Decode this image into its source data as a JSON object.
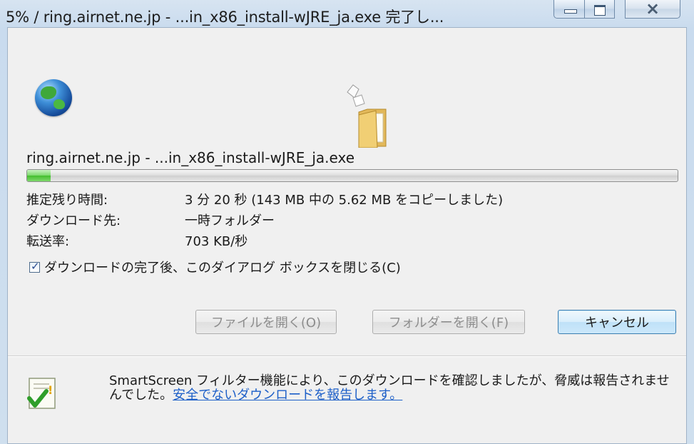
{
  "window": {
    "title": "5% / ring.airnet.ne.jp - ...in_x86_install-wJRE_ja.exe 完了し..."
  },
  "download": {
    "filename": "ring.airnet.ne.jp - ...in_x86_install-wJRE_ja.exe",
    "progress_fraction": 0.036,
    "rows": [
      {
        "label": "推定残り時間:",
        "value": "3 分 20 秒 (143 MB 中の 5.62 MB をコピーしました)"
      },
      {
        "label": "ダウンロード先:",
        "value": "一時フォルダー"
      },
      {
        "label": "転送率:",
        "value": "703 KB/秒"
      }
    ],
    "close_checkbox_label": "ダウンロードの完了後、このダイアログ ボックスを閉じる(C)",
    "close_checkbox_checked": true
  },
  "buttons": {
    "open_file": "ファイルを開く(O)",
    "open_folder": "フォルダーを開く(F)",
    "cancel": "キャンセル"
  },
  "smartscreen": {
    "message": "SmartScreen フィルター機能により、このダウンロードを確認しましたが、脅威は報告されませんでした。",
    "link": "安全でないダウンロードを報告します。"
  },
  "icons": {
    "globe": "globe-icon",
    "folder": "folder-transfer-icon",
    "shield": "smartscreen-check-icon"
  }
}
